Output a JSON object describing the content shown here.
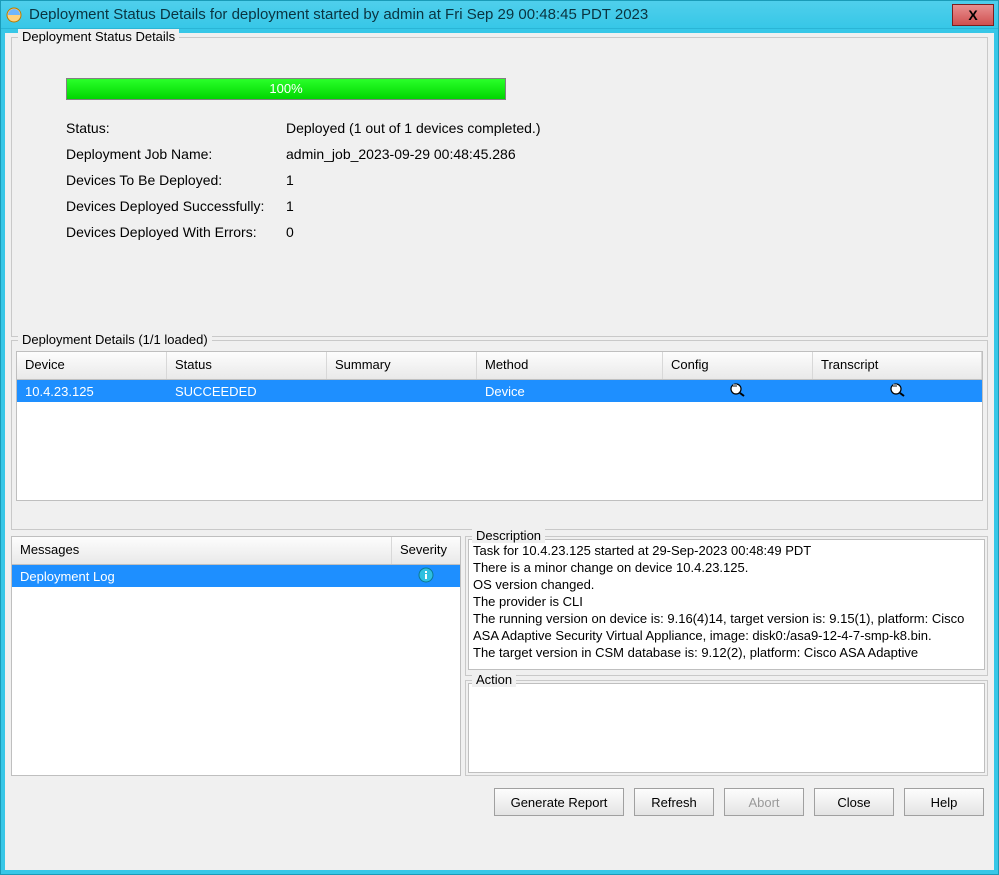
{
  "window": {
    "title": "Deployment Status Details for deployment started by admin at Fri Sep 29 00:48:45 PDT 2023",
    "close_label": "X"
  },
  "statusGroup": {
    "legend": "Deployment Status Details",
    "progressPercent": "100%",
    "rows": {
      "status_k": "Status:",
      "status_v": "Deployed  (1 out of 1 devices completed.)",
      "jobname_k": "Deployment Job Name:",
      "jobname_v": "admin_job_2023-09-29 00:48:45.286",
      "tobe_k": "Devices To Be Deployed:",
      "tobe_v": "1",
      "succ_k": "Devices Deployed Successfully:",
      "succ_v": "1",
      "err_k": "Devices Deployed With Errors:",
      "err_v": "0"
    }
  },
  "details": {
    "legend": "Deployment Details (1/1 loaded)",
    "columns": {
      "device": "Device",
      "status": "Status",
      "summary": "Summary",
      "method": "Method",
      "config": "Config",
      "transcript": "Transcript"
    },
    "rows": [
      {
        "device": "10.4.23.125",
        "status": "SUCCEEDED",
        "summary": "",
        "method": "Device"
      }
    ]
  },
  "messages": {
    "col_messages": "Messages",
    "col_severity": "Severity",
    "rows": [
      {
        "text": "Deployment Log",
        "severity_icon": "info"
      }
    ]
  },
  "description": {
    "legend": "Description",
    "text": "Task for 10.4.23.125 started at 29-Sep-2023 00:48:49 PDT\nThere is a minor change on device 10.4.23.125.\nOS version changed.\nThe provider is CLI\nThe running version on device is: 9.16(4)14, target version is: 9.15(1), platform: Cisco ASA Adaptive Security Virtual Appliance, image: disk0:/asa9-12-4-7-smp-k8.bin.\nThe target version in CSM database is: 9.12(2), platform: Cisco ASA Adaptive"
  },
  "action": {
    "legend": "Action",
    "text": ""
  },
  "buttons": {
    "generate": "Generate Report",
    "refresh": "Refresh",
    "abort": "Abort",
    "close": "Close",
    "help": "Help"
  }
}
